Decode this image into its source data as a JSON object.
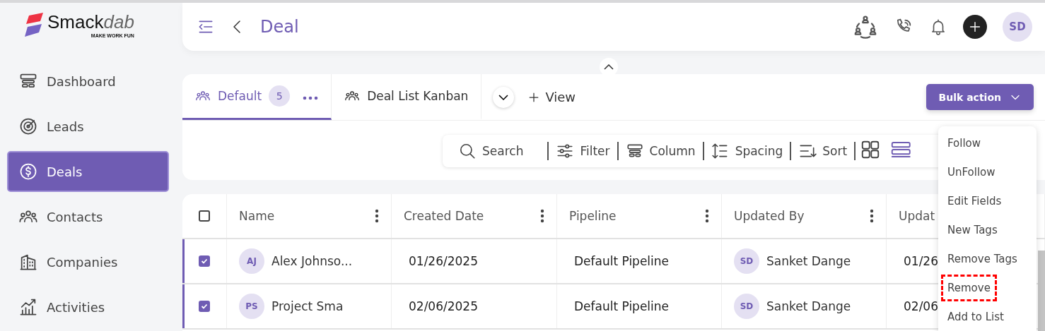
{
  "logo": {
    "name_bold": "Smack",
    "name_light": "dab",
    "tagline": "MAKE WORK FUN"
  },
  "sidebar": {
    "items": [
      {
        "label": "Dashboard",
        "selected": false
      },
      {
        "label": "Leads",
        "selected": false
      },
      {
        "label": "Deals",
        "selected": true
      },
      {
        "label": "Contacts",
        "selected": false
      },
      {
        "label": "Companies",
        "selected": false
      },
      {
        "label": "Activities",
        "selected": false
      }
    ]
  },
  "header": {
    "title": "Deal",
    "avatar": "SD"
  },
  "tabs": [
    {
      "label": "Default",
      "count": "5",
      "selected": true
    },
    {
      "label": "Deal List Kanban",
      "selected": false
    }
  ],
  "add_view": "View",
  "bulk_action": {
    "label": "Bulk action",
    "expanded": true
  },
  "toolbar": {
    "items": [
      "Search",
      "Filter",
      "Column",
      "Spacing",
      "Sort"
    ],
    "view_modes": [
      {
        "kind": "grid",
        "selected": false
      },
      {
        "kind": "list",
        "selected": true
      }
    ]
  },
  "table": {
    "all_checked": false,
    "columns": [
      "Name",
      "Created Date",
      "Pipeline",
      "Updated By",
      "Updat"
    ],
    "rows": [
      {
        "checked": true,
        "initials": "AJ",
        "name": "Alex Johnso...",
        "created": "01/26/2025",
        "pipeline": "Default Pipeline",
        "updater_initials": "SD",
        "updated_by": "Sanket Dange",
        "updated": "01/26"
      },
      {
        "checked": true,
        "initials": "PS",
        "name": "Project Sma",
        "created": "02/06/2025",
        "pipeline": "Default Pipeline",
        "updater_initials": "SD",
        "updated_by": "Sanket Dange",
        "updated": "02/06"
      }
    ]
  },
  "bulk_menu": {
    "items": [
      {
        "label": "Follow",
        "highlighted": false
      },
      {
        "label": "UnFollow",
        "highlighted": false
      },
      {
        "label": "Edit Fields",
        "highlighted": false
      },
      {
        "label": "New Tags",
        "highlighted": false
      },
      {
        "label": "Remove Tags",
        "highlighted": false
      },
      {
        "label": "Remove",
        "highlighted": true
      },
      {
        "label": "Add to List",
        "highlighted": false
      }
    ]
  }
}
